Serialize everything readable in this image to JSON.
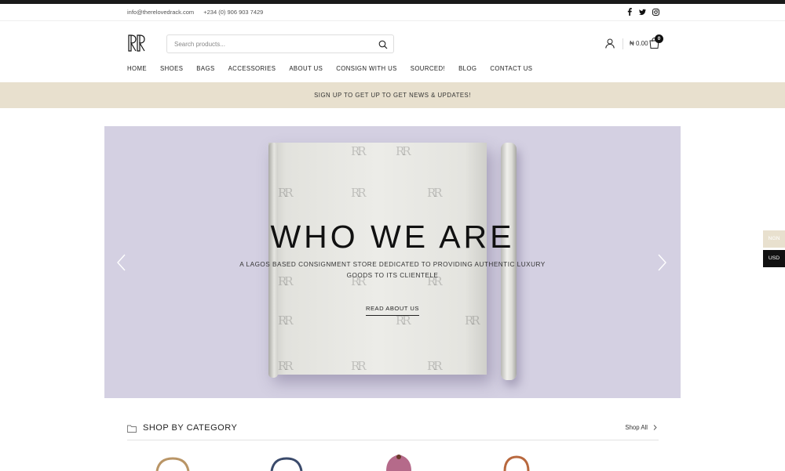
{
  "utility": {
    "email": "info@therelovedrack.com",
    "phone": "+234 (0) 906 903 7429"
  },
  "search": {
    "placeholder": "Search products..."
  },
  "cart": {
    "total": "₦ 0.00",
    "count": "0"
  },
  "nav": {
    "items": [
      "HOME",
      "SHOES",
      "BAGS",
      "ACCESSORIES",
      "ABOUT US",
      "CONSIGN WITH US",
      "SOURCED!",
      "BLOG",
      "CONTACT US"
    ]
  },
  "promo": {
    "text": "SIGN UP TO GET UP TO GET NEWS & UPDATES!"
  },
  "hero": {
    "title": "WHO WE ARE",
    "subtitle": "A LAGOS BASED CONSIGNMENT STORE DEDICATED TO PROVIDING AUTHENTIC LUXURY GOODS TO ITS CLIENTELE",
    "cta": "READ ABOUT US",
    "watermark": "RR"
  },
  "currency": {
    "ngn": "NGN",
    "usd": "USD"
  },
  "category": {
    "title": "SHOP BY CATEGORY",
    "shop_all": "Shop All"
  },
  "colors": {
    "promo_bg": "#e8e0ce",
    "hero_bg": "#d4d0e2",
    "topbar": "#1a1a1a"
  },
  "icons": [
    "facebook-icon",
    "twitter-icon",
    "instagram-icon",
    "search-icon",
    "user-icon",
    "cart-icon",
    "chevron-left-icon",
    "chevron-right-icon",
    "folder-icon",
    "chevron-right-small-icon"
  ]
}
